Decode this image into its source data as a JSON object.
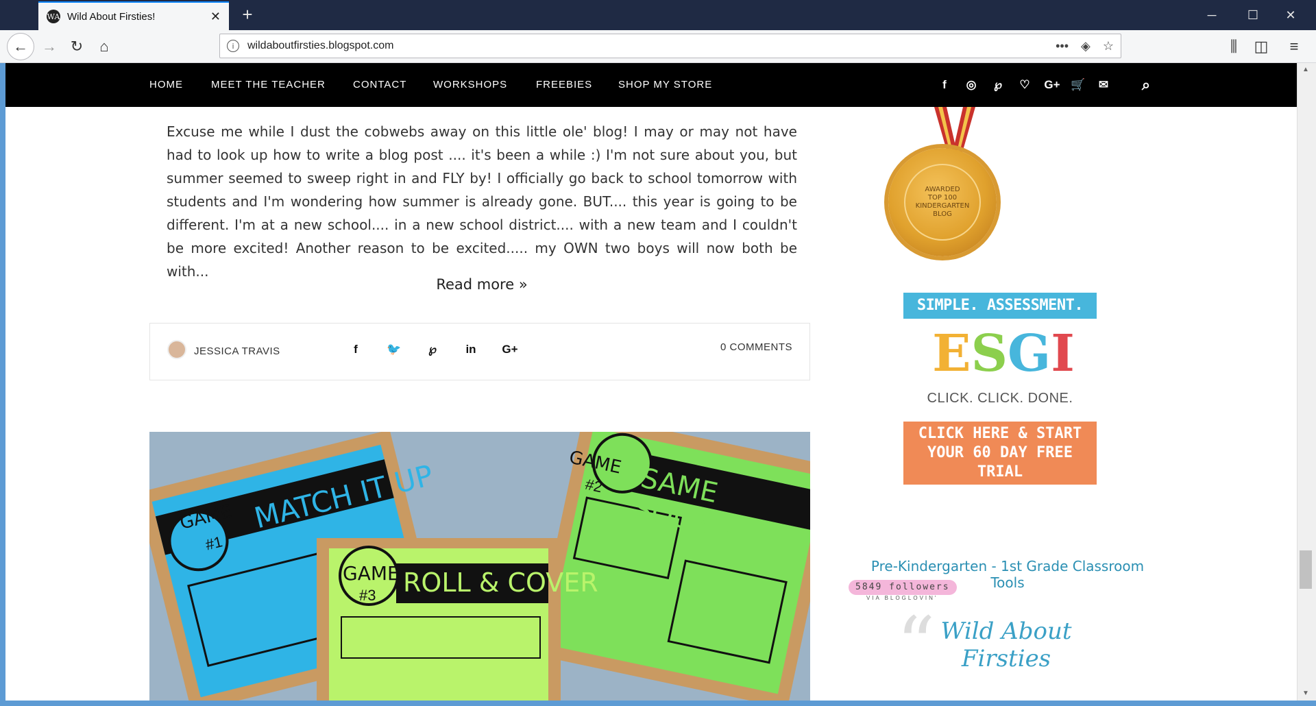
{
  "browser": {
    "tab_title": "Wild About Firsties!",
    "tab_favicon": "WA",
    "tab_close": "✕",
    "new_tab": "+",
    "url": "wildaboutfirsties.blogspot.com",
    "win_min": "─",
    "win_max": "☐",
    "win_close": "✕"
  },
  "toolbar": {
    "back": "←",
    "forward": "→",
    "reload": "↻",
    "home": "⌂",
    "page_actions": "•••",
    "pocket": "◈",
    "bookmark": "☆",
    "library": "⫼",
    "sidebar": "◫",
    "menu": "≡"
  },
  "nav": {
    "items": [
      "HOME",
      "MEET THE TEACHER",
      "CONTACT",
      "WORKSHOPS",
      "FREEBIES",
      "SHOP MY STORE"
    ],
    "icons": {
      "facebook": "f",
      "instagram": "◎",
      "pinterest": "℘",
      "bloglovin": "♡",
      "googleplus": "G+",
      "cart": "🛒",
      "email": "✉",
      "search": "⌕"
    }
  },
  "post": {
    "excerpt": "Excuse me while I dust the cobwebs away on this little ole' blog!  I may or may not have had to look up how to write a blog post .... it's been a while :) I'm not sure about you, but summer seemed to sweep right in and FLY by!  I officially go back to school tomorrow with students and I'm wondering how summer is already gone. BUT.... this year is going to be different.  I'm at a new school.... in a new school district.... with a new team and I couldn't be more excited!  Another reason to be excited..... my OWN two boys will now both be with...",
    "read_more": "Read more »",
    "author": "JESSICA TRAVIS",
    "comments": "0 COMMENTS",
    "share": {
      "facebook": "f",
      "twitter": "🐦",
      "pinterest": "℘",
      "linkedin": "in",
      "googleplus": "G+"
    },
    "image_cards": {
      "card1_game": "GAME",
      "card1_num": "#1",
      "card1_title": "MATCH IT UP",
      "card2_game": "GAME",
      "card2_num": "#2",
      "card2_title": "SAME SOUND",
      "card3_game": "GAME",
      "card3_num": "#3",
      "card3_title": "ROLL & COVER"
    }
  },
  "sidebar": {
    "medal_lines": [
      "AWARDED",
      "TOP 100",
      "KINDERGARTEN",
      "BLOG"
    ],
    "esgi_top": "SIMPLE. ASSESSMENT. SOFTWARE.",
    "esgi_letters": [
      "E",
      "S",
      "G",
      "I"
    ],
    "esgi_tagline": "CLICK. CLICK. DONE.",
    "esgi_cta": "CLICK HERE & START YOUR 60 DAY FREE TRIAL",
    "bloglovin_link": "Pre-Kindergarten - 1st Grade Classroom Tools",
    "followers": "5849 followers",
    "via": "VIA BLOGLOVIN'",
    "blog_title": "Wild About Firsties"
  },
  "colors": {
    "tabstrip": "#1f2a44",
    "nav_bg": "#000000",
    "accent_blue": "#3aa0c6",
    "esgi_blue": "#47b6dc",
    "esgi_orange": "#f08a56"
  }
}
